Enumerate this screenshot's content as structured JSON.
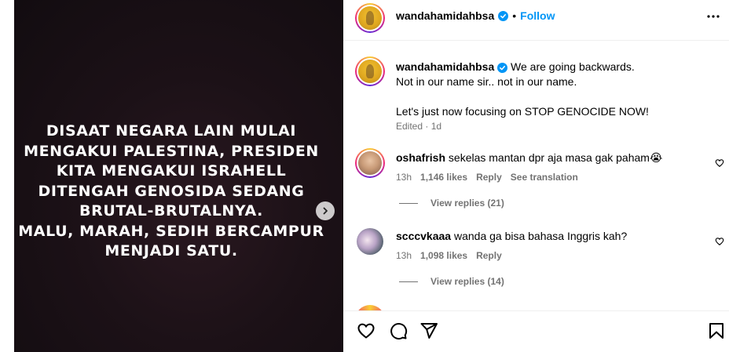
{
  "media": {
    "post_text_lines": [
      "DISAAT NEGARA LAIN MULAI",
      "MENGAKUI PALESTINA, PRESIDEN",
      "KITA MENGAKUI ISRAHELL",
      "DITENGAH GENOSIDA SEDANG",
      "BRUTAL-BRUTALNYA.",
      "MALU, MARAH, SEDIH BERCAMPUR",
      "MENJADI SATU."
    ],
    "next_icon": "chevron-right-icon"
  },
  "header": {
    "username": "wandahamidahbsa",
    "separator": "•",
    "follow_label": "Follow",
    "more_icon": "more-horizontal-icon"
  },
  "caption": {
    "username": "wandahamidahbsa",
    "lines": [
      "We are going backwards.",
      "Not in our name sir.. not in our name.",
      "",
      "Let's just now focusing on STOP GENOCIDE NOW!"
    ],
    "edited": "Edited",
    "dot": "·",
    "time": "1d"
  },
  "comments": [
    {
      "username": "oshafrish",
      "text": "sekelas mantan dpr aja masa gak paham😭",
      "time": "13h",
      "likes": "1,146 likes",
      "reply_label": "Reply",
      "translation_label": "See translation",
      "view_replies": "View replies (21)"
    },
    {
      "username": "scccvkaaa",
      "text": "wanda ga bisa bahasa Inggris kah?",
      "time": "13h",
      "likes": "1,098 likes",
      "reply_label": "Reply",
      "view_replies": "View replies (14)"
    }
  ],
  "actions": {
    "like_icon": "heart-icon",
    "comment_icon": "comment-icon",
    "share_icon": "share-icon",
    "save_icon": "bookmark-icon"
  },
  "colors": {
    "link_blue": "#0095f6",
    "muted": "#737373",
    "border": "#efefef",
    "media_bg": "#1a1016"
  }
}
